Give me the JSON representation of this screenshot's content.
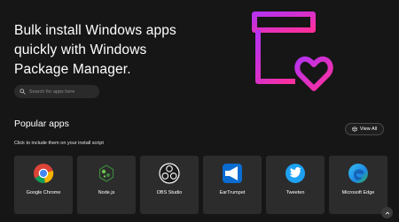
{
  "hero": {
    "title": "Bulk install Windows apps quickly with Windows Package Manager.",
    "art_icon": "box-heart-icon",
    "accent_gradient": [
      "#b532f0",
      "#ff2f9a"
    ]
  },
  "search": {
    "placeholder": "Search for apps here"
  },
  "popular": {
    "title": "Popular apps",
    "subtitle": "Click to include them on your install script",
    "view_all_label": "View All"
  },
  "apps": [
    {
      "name": "Google Chrome",
      "icon": "chrome-icon"
    },
    {
      "name": "Node.js",
      "icon": "nodejs-icon"
    },
    {
      "name": "OBS Studio",
      "icon": "obs-studio-icon"
    },
    {
      "name": "EarTrumpet",
      "icon": "eartrumpet-icon"
    },
    {
      "name": "Tweeten",
      "icon": "tweeten-icon"
    },
    {
      "name": "Microsoft Edge",
      "icon": "edge-icon"
    }
  ]
}
